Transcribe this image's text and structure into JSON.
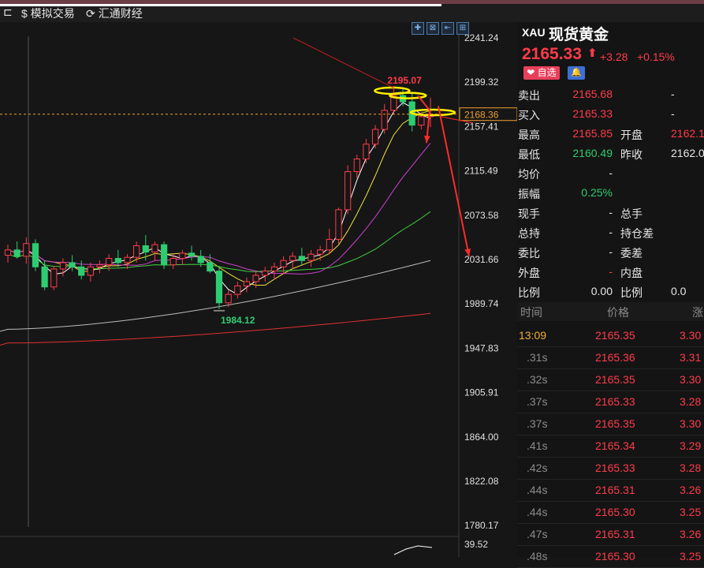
{
  "topbar": {
    "tabs": [
      {
        "icon": "dollar-icon",
        "glyph": "$",
        "label": "模拟交易"
      },
      {
        "icon": "refresh-icon",
        "glyph": "⟳",
        "label": "汇通财经"
      }
    ]
  },
  "toolbar": {
    "buttons": [
      "✚",
      "⊠",
      "⇤",
      "⊞"
    ]
  },
  "chart_data": {
    "type": "candlestick",
    "y_axis_labels": [
      "2241.24",
      "2199.32",
      "2157.41",
      "2115.49",
      "2073.58",
      "2031.66",
      "1989.74",
      "1947.83",
      "1905.91",
      "1864.00",
      "1822.08",
      "1780.17"
    ],
    "current_price_label": "2168.36",
    "high_annotation": "2195.07",
    "low_annotation": "1984.12",
    "sub_indicator_label": "39.52",
    "ylim": [
      1780.17,
      2241.24
    ],
    "candles": [
      {
        "o": 2035,
        "h": 2045,
        "l": 2028,
        "c": 2040
      },
      {
        "o": 2040,
        "h": 2048,
        "l": 2032,
        "c": 2034
      },
      {
        "o": 2034,
        "h": 2052,
        "l": 2027,
        "c": 2046
      },
      {
        "o": 2046,
        "h": 2050,
        "l": 2020,
        "c": 2024
      },
      {
        "o": 2024,
        "h": 2030,
        "l": 2002,
        "c": 2005
      },
      {
        "o": 2005,
        "h": 2025,
        "l": 2002,
        "c": 2022
      },
      {
        "o": 2022,
        "h": 2032,
        "l": 2015,
        "c": 2028
      },
      {
        "o": 2028,
        "h": 2035,
        "l": 2020,
        "c": 2024
      },
      {
        "o": 2024,
        "h": 2030,
        "l": 2012,
        "c": 2016
      },
      {
        "o": 2016,
        "h": 2028,
        "l": 2010,
        "c": 2024
      },
      {
        "o": 2024,
        "h": 2030,
        "l": 2018,
        "c": 2026
      },
      {
        "o": 2026,
        "h": 2036,
        "l": 2020,
        "c": 2032
      },
      {
        "o": 2032,
        "h": 2040,
        "l": 2024,
        "c": 2028
      },
      {
        "o": 2028,
        "h": 2036,
        "l": 2022,
        "c": 2033
      },
      {
        "o": 2033,
        "h": 2048,
        "l": 2028,
        "c": 2044
      },
      {
        "o": 2044,
        "h": 2054,
        "l": 2030,
        "c": 2038
      },
      {
        "o": 2038,
        "h": 2048,
        "l": 2030,
        "c": 2045
      },
      {
        "o": 2045,
        "h": 2048,
        "l": 2022,
        "c": 2026
      },
      {
        "o": 2026,
        "h": 2036,
        "l": 2022,
        "c": 2032
      },
      {
        "o": 2032,
        "h": 2040,
        "l": 2026,
        "c": 2037
      },
      {
        "o": 2037,
        "h": 2044,
        "l": 2030,
        "c": 2034
      },
      {
        "o": 2034,
        "h": 2040,
        "l": 2024,
        "c": 2028
      },
      {
        "o": 2028,
        "h": 2036,
        "l": 2018,
        "c": 2020
      },
      {
        "o": 2020,
        "h": 2024,
        "l": 1984,
        "c": 1990
      },
      {
        "o": 1990,
        "h": 2002,
        "l": 1986,
        "c": 1998
      },
      {
        "o": 1998,
        "h": 2010,
        "l": 1994,
        "c": 2006
      },
      {
        "o": 2006,
        "h": 2014,
        "l": 2000,
        "c": 2010
      },
      {
        "o": 2010,
        "h": 2020,
        "l": 2004,
        "c": 2016
      },
      {
        "o": 2016,
        "h": 2024,
        "l": 2010,
        "c": 2020
      },
      {
        "o": 2020,
        "h": 2028,
        "l": 2012,
        "c": 2024
      },
      {
        "o": 2024,
        "h": 2034,
        "l": 2018,
        "c": 2030
      },
      {
        "o": 2030,
        "h": 2038,
        "l": 2022,
        "c": 2034
      },
      {
        "o": 2034,
        "h": 2042,
        "l": 2026,
        "c": 2030
      },
      {
        "o": 2030,
        "h": 2040,
        "l": 2024,
        "c": 2036
      },
      {
        "o": 2036,
        "h": 2044,
        "l": 2030,
        "c": 2040
      },
      {
        "o": 2040,
        "h": 2060,
        "l": 2036,
        "c": 2050
      },
      {
        "o": 2050,
        "h": 2080,
        "l": 2046,
        "c": 2078
      },
      {
        "o": 2078,
        "h": 2120,
        "l": 2074,
        "c": 2114
      },
      {
        "o": 2114,
        "h": 2130,
        "l": 2108,
        "c": 2126
      },
      {
        "o": 2126,
        "h": 2145,
        "l": 2122,
        "c": 2140
      },
      {
        "o": 2140,
        "h": 2158,
        "l": 2136,
        "c": 2154
      },
      {
        "o": 2154,
        "h": 2178,
        "l": 2150,
        "c": 2172
      },
      {
        "o": 2172,
        "h": 2195,
        "l": 2168,
        "c": 2186
      },
      {
        "o": 2186,
        "h": 2194,
        "l": 2176,
        "c": 2180
      },
      {
        "o": 2180,
        "h": 2188,
        "l": 2152,
        "c": 2158
      },
      {
        "o": 2158,
        "h": 2170,
        "l": 2154,
        "c": 2166
      },
      {
        "o": 2166,
        "h": 2184,
        "l": 2156,
        "c": 2168
      }
    ]
  },
  "panel": {
    "code": "XAU",
    "name": "现货黄金",
    "price": "2165.33",
    "arrow": "⬆",
    "change": "+3.28",
    "change_pct": "+0.15%",
    "fav_label": "❤ 自选",
    "bell_glyph": "🔔",
    "quote_rows": [
      {
        "l1": "卖出",
        "v1": "2165.68",
        "c1": "red",
        "l2": "",
        "v2": "-",
        "c2": "white"
      },
      {
        "l1": "买入",
        "v1": "2165.33",
        "c1": "red",
        "l2": "",
        "v2": "-",
        "c2": "white"
      },
      {
        "l1": "最高",
        "v1": "2165.85",
        "c1": "red",
        "l2": "开盘",
        "v2": "2162.1",
        "c2": "red"
      },
      {
        "l1": "最低",
        "v1": "2160.49",
        "c1": "green",
        "l2": "昨收",
        "v2": "2162.0",
        "c2": "white"
      },
      {
        "l1": "均价",
        "v1": "-",
        "c1": "white",
        "l2": "",
        "v2": "",
        "c2": "white"
      },
      {
        "l1": "振幅",
        "v1": "0.25%",
        "c1": "green",
        "l2": "",
        "v2": "",
        "c2": "white"
      },
      {
        "l1": "现手",
        "v1": "-",
        "c1": "white",
        "l2": "总手",
        "v2": "",
        "c2": "white"
      },
      {
        "l1": "总持",
        "v1": "-",
        "c1": "white",
        "l2": "持仓差",
        "v2": "",
        "c2": "white"
      },
      {
        "l1": "委比",
        "v1": "-",
        "c1": "white",
        "l2": "委差",
        "v2": "",
        "c2": "white"
      },
      {
        "l1": "外盘",
        "v1": "-",
        "c1": "red",
        "l2": "内盘",
        "v2": "",
        "c2": "white"
      },
      {
        "l1": "比例",
        "v1": "0.00",
        "c1": "white",
        "l2": "比例",
        "v2": "0.0",
        "c2": "white"
      }
    ],
    "ticks_header": {
      "time": "时间",
      "price": "价格",
      "chg": "涨"
    },
    "ticks": [
      {
        "t": "13:09",
        "p": "2165.35",
        "c": "3.30",
        "hl": true
      },
      {
        "t": ".31s",
        "p": "2165.36",
        "c": "3.31"
      },
      {
        "t": ".32s",
        "p": "2165.35",
        "c": "3.30"
      },
      {
        "t": ".37s",
        "p": "2165.33",
        "c": "3.28"
      },
      {
        "t": ".37s",
        "p": "2165.35",
        "c": "3.30"
      },
      {
        "t": ".41s",
        "p": "2165.34",
        "c": "3.29"
      },
      {
        "t": ".42s",
        "p": "2165.33",
        "c": "3.28"
      },
      {
        "t": ".44s",
        "p": "2165.31",
        "c": "3.26"
      },
      {
        "t": ".44s",
        "p": "2165.30",
        "c": "3.25"
      },
      {
        "t": ".47s",
        "p": "2165.31",
        "c": "3.26"
      },
      {
        "t": ".48s",
        "p": "2165.30",
        "c": "3.25"
      }
    ]
  },
  "colors": {
    "up": "#ff3b4a",
    "down": "#2ecc71",
    "ma5": "#ffffff",
    "ma10": "#f0e040",
    "ma20": "#d040d0",
    "ma60": "#40d040",
    "ma120": "#bbbbbb",
    "ma250": "#e03030",
    "annotation": "#ffee00"
  }
}
